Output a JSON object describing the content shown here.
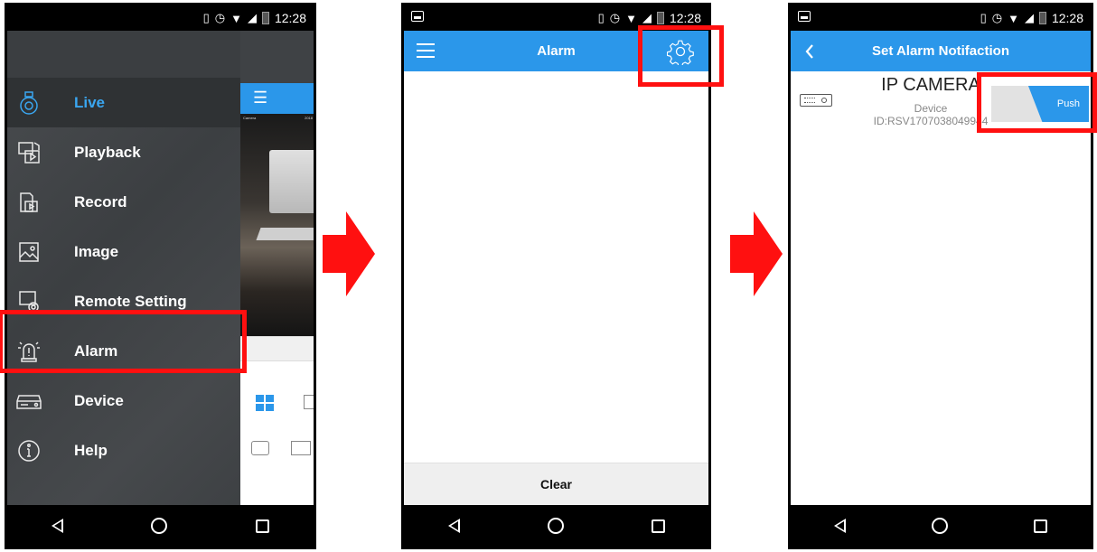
{
  "status": {
    "time": "12:28"
  },
  "screen1": {
    "menu": [
      {
        "id": "live",
        "label": "Live",
        "icon": "camera-icon",
        "active": true
      },
      {
        "id": "playback",
        "label": "Playback",
        "icon": "playback-icon"
      },
      {
        "id": "record",
        "label": "Record",
        "icon": "record-icon"
      },
      {
        "id": "image",
        "label": "Image",
        "icon": "image-icon"
      },
      {
        "id": "remote",
        "label": "Remote Setting",
        "icon": "remote-setting-icon"
      },
      {
        "id": "alarm",
        "label": "Alarm",
        "icon": "alarm-icon"
      },
      {
        "id": "device",
        "label": "Device",
        "icon": "device-icon"
      },
      {
        "id": "help",
        "label": "Help",
        "icon": "help-icon"
      }
    ],
    "peek": {
      "camera_label": "Camera",
      "camera_number": "2018"
    }
  },
  "screen2": {
    "title": "Alarm",
    "clear_label": "Clear"
  },
  "screen3": {
    "title": "Set Alarm Notifaction",
    "device_name": "IP CAMERA",
    "device_label": "Device",
    "device_id": "ID:RSV1707038049944",
    "push_label": "Push"
  },
  "colors": {
    "accent": "#2b97ea",
    "highlight": "#ff1010",
    "drawer": "#3f4245"
  }
}
